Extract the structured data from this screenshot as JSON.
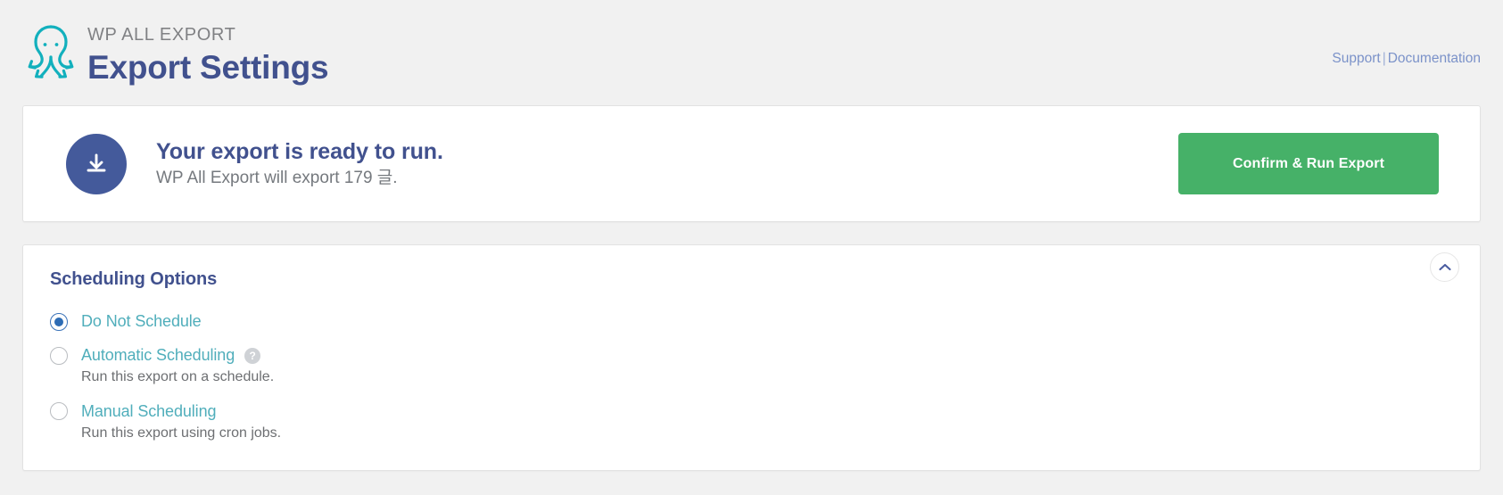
{
  "header": {
    "eyebrow": "WP ALL EXPORT",
    "title": "Export Settings",
    "logo_icon": "octopus-logo-icon",
    "links": {
      "support": "Support",
      "separator": "|",
      "documentation": "Documentation"
    }
  },
  "confirm_panel": {
    "icon": "download-icon",
    "title": "Your export is ready to run.",
    "subtitle": "WP All Export will export 179 글.",
    "button_label": "Confirm & Run Export",
    "button_color": "#46b168",
    "badge_color": "#445a9b"
  },
  "scheduling": {
    "title": "Scheduling Options",
    "collapse_icon": "chevron-up-icon",
    "options": [
      {
        "label": "Do Not Schedule",
        "selected": true,
        "description": "",
        "has_help": false
      },
      {
        "label": "Automatic Scheduling",
        "selected": false,
        "description": "Run this export on a schedule.",
        "has_help": true,
        "help_glyph": "?"
      },
      {
        "label": "Manual Scheduling",
        "selected": false,
        "description": "Run this export using cron jobs.",
        "has_help": false
      }
    ],
    "accent_color": "#50aebb",
    "heading_color": "#41518e"
  }
}
